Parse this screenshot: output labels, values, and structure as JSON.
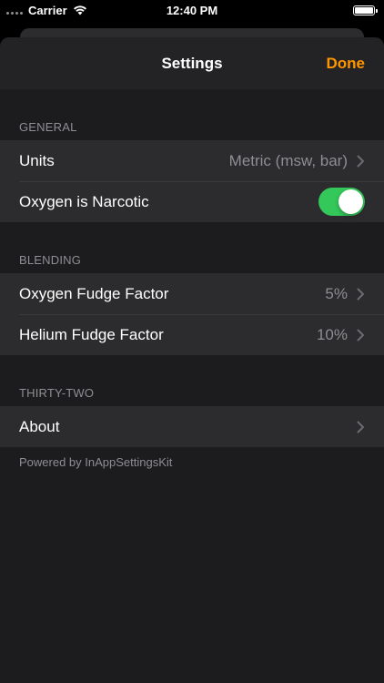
{
  "status_bar": {
    "carrier": "Carrier",
    "time": "12:40 PM",
    "icons": [
      "signal-dots-icon",
      "wifi-icon",
      "battery-icon"
    ]
  },
  "nav": {
    "title": "Settings",
    "done_label": "Done",
    "accent_color": "#ff9500"
  },
  "sections": {
    "general": {
      "header": "GENERAL",
      "units": {
        "label": "Units",
        "value": "Metric (msw, bar)"
      },
      "oxygen_narcotic": {
        "label": "Oxygen is Narcotic",
        "on": true
      }
    },
    "blending": {
      "header": "BLENDING",
      "oxygen_fudge": {
        "label": "Oxygen Fudge Factor",
        "value": "5%"
      },
      "helium_fudge": {
        "label": "Helium Fudge Factor",
        "value": "10%"
      }
    },
    "thirty_two": {
      "header": "THIRTY-TWO",
      "about": {
        "label": "About"
      }
    }
  },
  "footer": "Powered by InAppSettingsKit",
  "colors": {
    "toggle_on": "#34c759",
    "secondary_text": "#8e8e93"
  }
}
